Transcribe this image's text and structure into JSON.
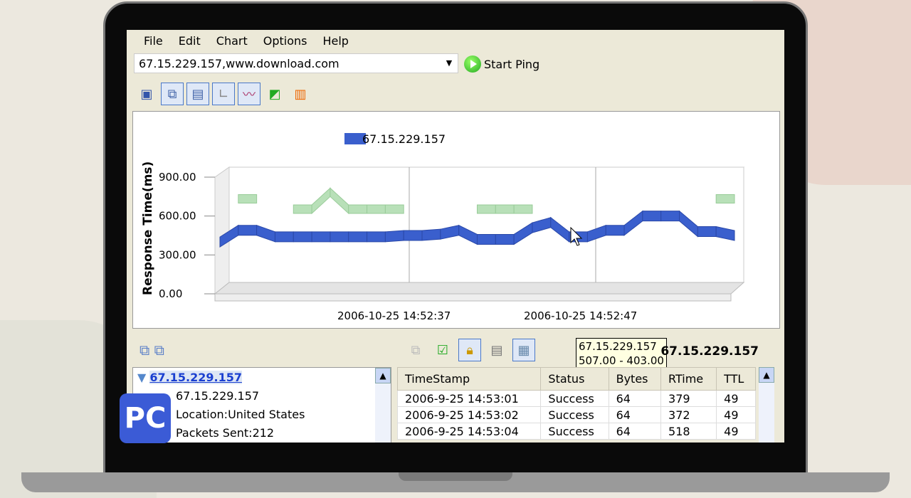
{
  "menu": [
    "File",
    "Edit",
    "Chart",
    "Options",
    "Help"
  ],
  "address": {
    "value": "67.15.229.157,www.download.com"
  },
  "start_ping_label": "Start Ping",
  "toolbar_icons": [
    "save-icon",
    "options-icon",
    "list-view-icon",
    "grid-view-icon",
    "line-chart-icon",
    "area-chart-icon",
    "bar-chart-icon"
  ],
  "chart_data": {
    "type": "area",
    "legend": [
      "67.15.229.157"
    ],
    "ylabel": "Response Time(ms)",
    "yticks": [
      "0.00",
      "300.00",
      "600.00",
      "900.00"
    ],
    "ylim": [
      0,
      900
    ],
    "xticks": [
      "2006-10-25 14:52:37",
      "2006-10-25 14:52:47"
    ],
    "series": [
      {
        "name": "67.15.229.157",
        "color": "#3a5fcd",
        "values": [
          400,
          490,
          490,
          440,
          440,
          440,
          440,
          440,
          440,
          440,
          450,
          450,
          460,
          490,
          420,
          420,
          420,
          510,
          550,
          440,
          440,
          490,
          490,
          600,
          600,
          600,
          480,
          480,
          450
        ]
      },
      {
        "name": "",
        "color": "#b8e0b8",
        "values": [
          null,
          700,
          700,
          null,
          620,
          620,
          750,
          620,
          620,
          620,
          620,
          null,
          null,
          null,
          620,
          620,
          620,
          620,
          null,
          null,
          null,
          null,
          null,
          null,
          null,
          null,
          null,
          700,
          700
        ]
      }
    ]
  },
  "tooltip": {
    "host": "67.15.229.157",
    "range": "507.00 - 403.00"
  },
  "tree": {
    "root": "67.15.229.157",
    "items": [
      "67.15.229.157",
      "Location:United States",
      "Packets Sent:212"
    ]
  },
  "results": {
    "host": "67.15.229.157",
    "columns": [
      "TimeStamp",
      "Status",
      "Bytes",
      "RTime",
      "TTL"
    ],
    "rows": [
      [
        "2006-9-25 14:53:01",
        "Success",
        "64",
        "379",
        "49"
      ],
      [
        "2006-9-25 14:53:02",
        "Success",
        "64",
        "372",
        "49"
      ],
      [
        "2006-9-25 14:53:04",
        "Success",
        "64",
        "518",
        "49"
      ]
    ]
  }
}
